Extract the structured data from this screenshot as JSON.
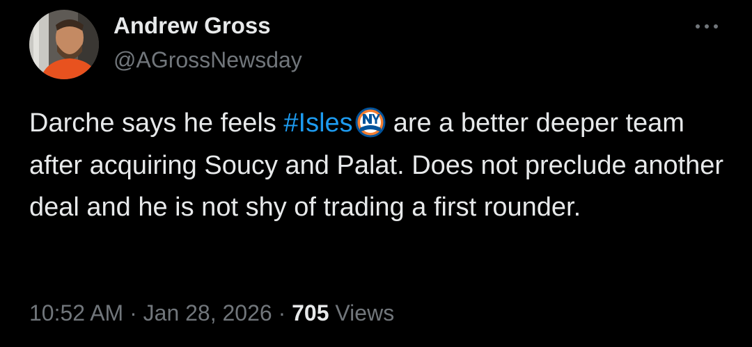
{
  "author": {
    "display_name": "Andrew Gross",
    "handle": "@AGrossNewsday"
  },
  "tweet": {
    "text_before_hashtag": "Darche says he feels ",
    "hashtag": "#Isles",
    "hashflag_icon": "ny-islanders-logo-icon",
    "text_after_hashtag": "are a better deeper team after acquiring Soucy and Palat. Does not preclude another deal and he is not shy of trading a first rounder."
  },
  "meta": {
    "time": "10:52 AM",
    "separator": " · ",
    "date": "Jan 28, 2026",
    "views_count": "705",
    "views_label": " Views"
  },
  "actions": {
    "more_icon": "more-horizontal-icon"
  },
  "colors": {
    "background": "#000000",
    "primary_text": "#e7e9ea",
    "secondary_text": "#71767b",
    "link": "#1d9bf0"
  }
}
